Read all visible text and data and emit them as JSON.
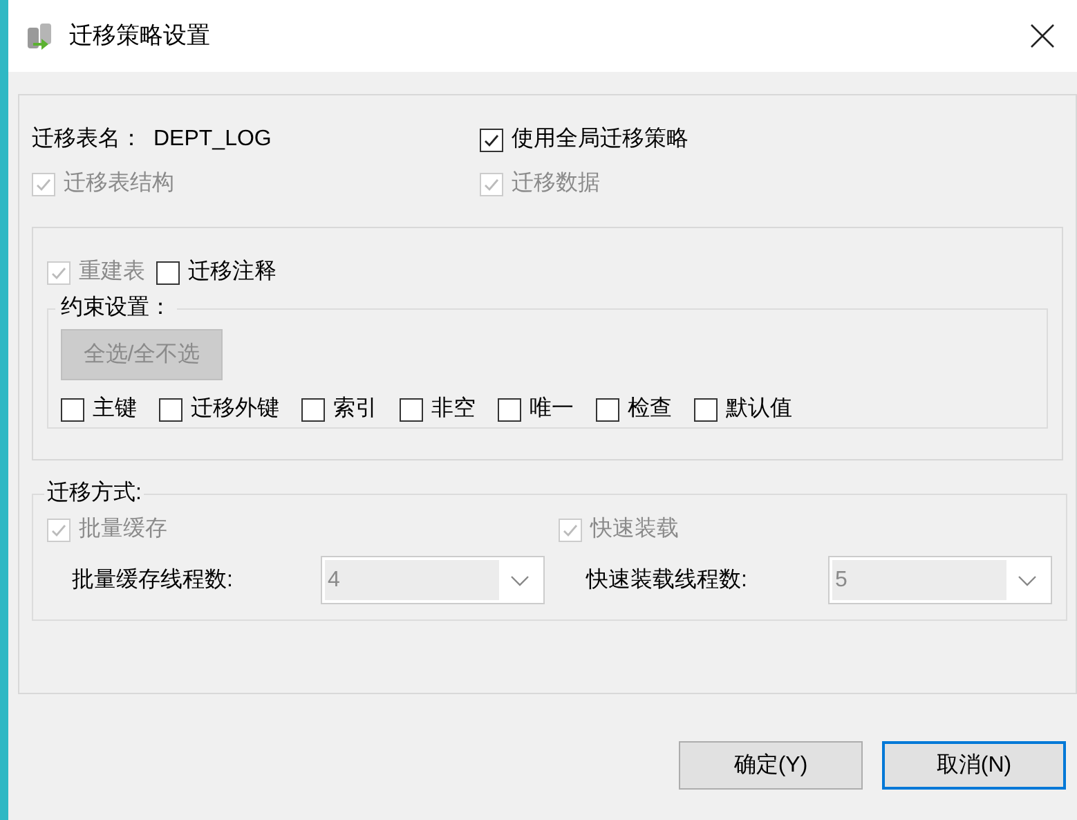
{
  "window": {
    "title": "迁移策略设置"
  },
  "table_name": {
    "label": "迁移表名：",
    "value": "DEPT_LOG"
  },
  "use_global": {
    "label": "使用全局迁移策略",
    "checked": true,
    "disabled": false
  },
  "migrate_structure": {
    "label": "迁移表结构",
    "checked": true,
    "disabled": true
  },
  "migrate_data": {
    "label": "迁移数据",
    "checked": true,
    "disabled": true
  },
  "options": [
    {
      "label": "重建表",
      "checked": true,
      "disabled": true
    },
    {
      "label": "迁移注释",
      "checked": false,
      "disabled": false
    }
  ],
  "constraints": {
    "title": "约束设置：",
    "select_all": {
      "label": "全选/全不选",
      "disabled": true
    },
    "items": [
      {
        "label": "主键",
        "checked": false,
        "disabled": false
      },
      {
        "label": "迁移外键",
        "checked": false,
        "disabled": false
      },
      {
        "label": "索引",
        "checked": false,
        "disabled": false
      },
      {
        "label": "非空",
        "checked": false,
        "disabled": false
      },
      {
        "label": "唯一",
        "checked": false,
        "disabled": false
      },
      {
        "label": "检查",
        "checked": false,
        "disabled": false
      },
      {
        "label": "默认值",
        "checked": false,
        "disabled": false
      }
    ]
  },
  "method": {
    "title": "迁移方式:",
    "batch_cache": {
      "label": "批量缓存",
      "checked": true,
      "disabled": true
    },
    "fast_load": {
      "label": "快速装载",
      "checked": true,
      "disabled": true
    },
    "batch_threads": {
      "label": "批量缓存线程数:",
      "value": "4",
      "disabled": true
    },
    "fast_threads": {
      "label": "快速装载线程数:",
      "value": "5",
      "disabled": true
    }
  },
  "buttons": [
    {
      "label": "确定(Y)",
      "default": false
    },
    {
      "label": "取消(N)",
      "default": true
    }
  ]
}
